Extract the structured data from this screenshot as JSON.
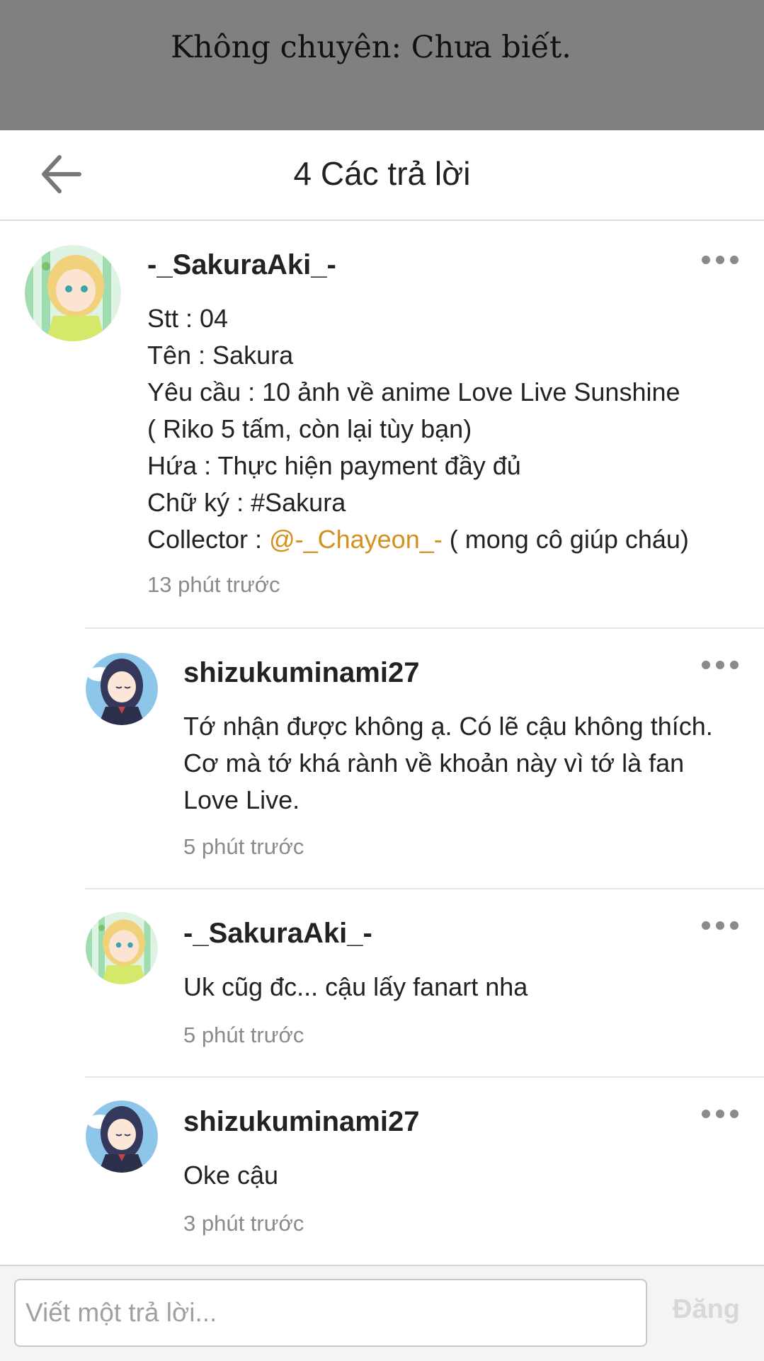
{
  "banner": {
    "text": "Không chuyên: Chưa biết."
  },
  "header": {
    "title": "4 Các trả lời",
    "back_icon": "arrow-left-icon"
  },
  "comments": [
    {
      "username": "-_SakuraAki_-",
      "avatar": "anime-girl-blonde-avatar",
      "lines": [
        "Stt : 04",
        "Tên : Sakura",
        "Yêu cầu : 10 ảnh về anime Love Live Sunshine",
        "( Riko 5 tấm, còn lại tùy bạn)",
        "Hứa : Thực hiện payment đầy đủ",
        "Chữ ký : #Sakura"
      ],
      "collector_label": "Collector : ",
      "collector_mention": "@-_Chayeon_-",
      "collector_suffix": " ( mong cô giúp cháu)",
      "time": "13 phút trước"
    },
    {
      "username": "shizukuminami27",
      "avatar": "anime-girl-dark-hair-avatar",
      "lines": [
        "Tớ nhận được không ạ. Có lẽ cậu không thích.",
        "Cơ mà tớ khá rành về khoản này vì tớ là fan",
        "Love Live."
      ],
      "time": "5 phút trước"
    },
    {
      "username": "-_SakuraAki_-",
      "avatar": "anime-girl-blonde-avatar",
      "lines": [
        "Uk cũg đc... cậu lấy fanart nha"
      ],
      "time": "5 phút trước"
    },
    {
      "username": "shizukuminami27",
      "avatar": "anime-girl-dark-hair-avatar",
      "lines": [
        "Oke cậu"
      ],
      "time": "3 phút trước"
    }
  ],
  "composer": {
    "placeholder": "Viết một trả lời...",
    "post_label": "Đăng"
  },
  "colors": {
    "mention": "#d4901e",
    "banner_bg": "#808080",
    "time": "#8a8a8a"
  }
}
